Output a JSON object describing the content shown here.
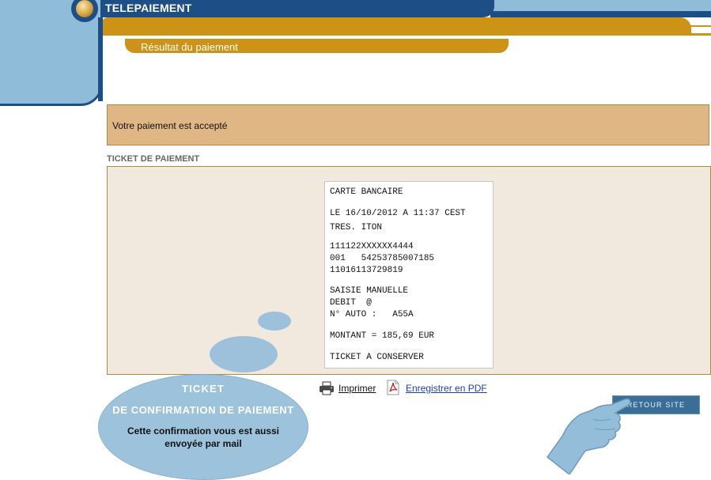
{
  "header": {
    "title": "TELEPAIEMENT",
    "subtitle": "Résultat du paiement"
  },
  "status": {
    "message": "Votre paiement est accepté"
  },
  "ticket": {
    "heading": "TICKET DE PAIEMENT",
    "lines": [
      "CARTE BANCAIRE",
      "LE 16/10/2012 A 11:37 CEST",
      "TRES. ITON",
      "111122XXXXXX4444",
      "001   54253785007185",
      "11016113729819",
      "SAISIE MANUELLE",
      "DEBIT  @",
      "N° AUTO :   A55A",
      "MONTANT = 185,69 EUR",
      "TICKET A CONSERVER"
    ]
  },
  "actions": {
    "print_label": "Imprimer",
    "pdf_label": "Enregistrer en PDF",
    "back_label": "RETOUR SITE"
  },
  "callout": {
    "title_line1": "TICKET",
    "title_line2": "DE CONFIRMATION DE PAIEMENT",
    "text": "Cette confirmation vous est aussi envoyée par mail"
  },
  "icons": {
    "print": "printer-icon",
    "pdf": "pdf-icon",
    "pointer": "pointing-hand-icon"
  },
  "colors": {
    "navy": "#1d4e86",
    "light_blue": "#8fbcd8",
    "orange": "#cc9317",
    "status_bg": "#dfb785",
    "ticket_bg": "#f2e9de",
    "button_bg": "#3a6e96"
  }
}
